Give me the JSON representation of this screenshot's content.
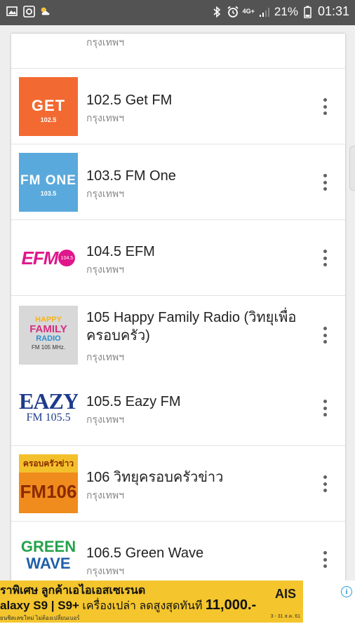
{
  "status_bar": {
    "battery_percent": "21%",
    "time": "01:31",
    "network": "4G+",
    "left_icons": [
      "image-icon",
      "camera-icon",
      "weather-icon"
    ],
    "right_icons": [
      "bluetooth-icon",
      "alarm-icon",
      "signal-icon",
      "battery-icon"
    ]
  },
  "stations": [
    {
      "name": "",
      "location": "กรุงเทพฯ",
      "logo": "emblem",
      "logo_lines": []
    },
    {
      "name": "102.5 Get FM",
      "location": "กรุงเทพฯ",
      "logo": "get",
      "logo_lines": [
        "GET",
        "102.5"
      ],
      "logo_color": "#f26a32"
    },
    {
      "name": "103.5 FM One",
      "location": "กรุงเทพฯ",
      "logo": "fmone",
      "logo_lines": [
        "FM ONE",
        "103.5"
      ],
      "logo_color": "#5aa9dc"
    },
    {
      "name": "104.5 EFM",
      "location": "กรุงเทพฯ",
      "logo": "efm",
      "logo_lines": [
        "EFM",
        "104.5"
      ],
      "logo_color": "#e0168b"
    },
    {
      "name": "105 Happy Family Radio (วิทยุเพื่อครอบครัว)",
      "location": "กรุงเทพฯ",
      "logo": "happy",
      "logo_lines": [
        "HAPPY",
        "FAMILY",
        "RADIO",
        "FM 105 MHz."
      ]
    },
    {
      "name": "105.5 Eazy FM",
      "location": "กรุงเทพฯ",
      "logo": "eazy",
      "logo_lines": [
        "EAZY",
        "FM 105.5"
      ],
      "logo_color": "#1d3b8c"
    },
    {
      "name": "106 วิทยุครอบครัวข่าว",
      "location": "กรุงเทพฯ",
      "logo": "106",
      "logo_lines": [
        "ครอบครัวข่าว",
        "FM106"
      ]
    },
    {
      "name": "106.5 Green Wave",
      "location": "กรุงเทพฯ",
      "logo": "green",
      "logo_lines": [
        "GREEN",
        "WAVE"
      ]
    }
  ],
  "ad": {
    "line1": "ราพิเศษ ลูกค้าเอไอเอสเซเรนด",
    "line2_model": "alaxy S9 | S9+",
    "line2_text": " เครื่องเปล่า ลดสูงสุดทันที ",
    "price": "11,000.-",
    "line3": "ยนชิดเลขใหม่ ไม่ต้องเปลี่ยนเบอร์",
    "brand": "AIS",
    "date": "3 - 31 ส.ค. 61",
    "info_label": "i"
  }
}
